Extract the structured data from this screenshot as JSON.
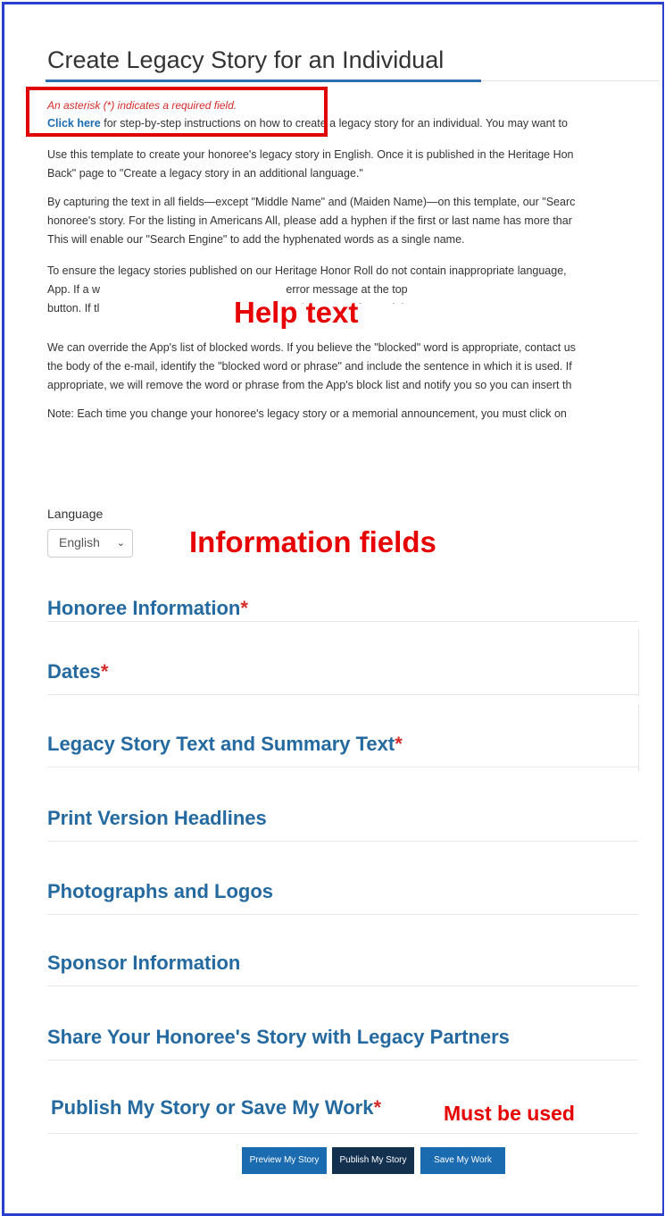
{
  "page": {
    "title": "Create Legacy Story for an Individual",
    "required_note": "An asterisk (*) indicates a required field.",
    "click_here": "Click here",
    "instructions_tail": " for step-by-step instructions on how to create a legacy story for an individual. You may want to",
    "para1_line1": "Use this template to create your honoree's legacy story in English. Once it is published in the Heritage Hon",
    "para1_line2": "Back\" page to \"Create a legacy story in an additional language.\"",
    "para2_line1": "By capturing the text in all fields—except \"Middle Name\" and (Maiden Name)—on this template, our \"Searc",
    "para2_line2": "honoree's story. For the listing in Americans All, please add a hyphen if the first or last name has more thar",
    "para2_line3": "This will enable our \"Search Engine\" to add the hyphenated words as a single name.",
    "para3_line1": "To ensure the legacy stories published on our Heritage Honor Roll do not contain inappropriate language,",
    "para3_line2": "App. If a w                                                            error message at the top",
    "para3_line3": "button. If tl                                                            and put an \"x\" for each le",
    "para4_line1": "We can override the App's list of blocked words. If you believe the \"blocked\" word is appropriate, contact us",
    "para4_line2": "the body of the e-mail, identify the \"blocked word or phrase\" and include the sentence in which it is used. If",
    "para4_line3": "appropriate, we will remove the word or phrase from the App's block list and notify you so you can insert th",
    "note": "Note: Each time you change your honoree's legacy story or a memorial announcement, you must click on"
  },
  "annotations": {
    "help_text": "Help text",
    "information_fields": "Information fields",
    "must_be_used": "Must be used"
  },
  "language": {
    "label": "Language",
    "selected": "English",
    "chevron_icon": "chevron-down-icon"
  },
  "sections": {
    "honoree": "Honoree Information",
    "dates": "Dates",
    "legacy_text": "Legacy Story Text and Summary Text",
    "print_headlines": "Print Version Headlines",
    "photos": "Photographs and Logos",
    "sponsor": "Sponsor Information",
    "share": "Share Your Honoree's Story with Legacy Partners",
    "publish": "Publish My Story or Save My Work",
    "asterisk": "*"
  },
  "buttons": {
    "preview": "Preview My Story",
    "publish": "Publish My Story",
    "save": "Save My Work"
  },
  "colors": {
    "frame": "#2b3fcf",
    "heading_blue": "#24699f",
    "annotation_red": "#e60000",
    "button_blue": "#1a6bb0",
    "button_dark": "#13314f"
  }
}
